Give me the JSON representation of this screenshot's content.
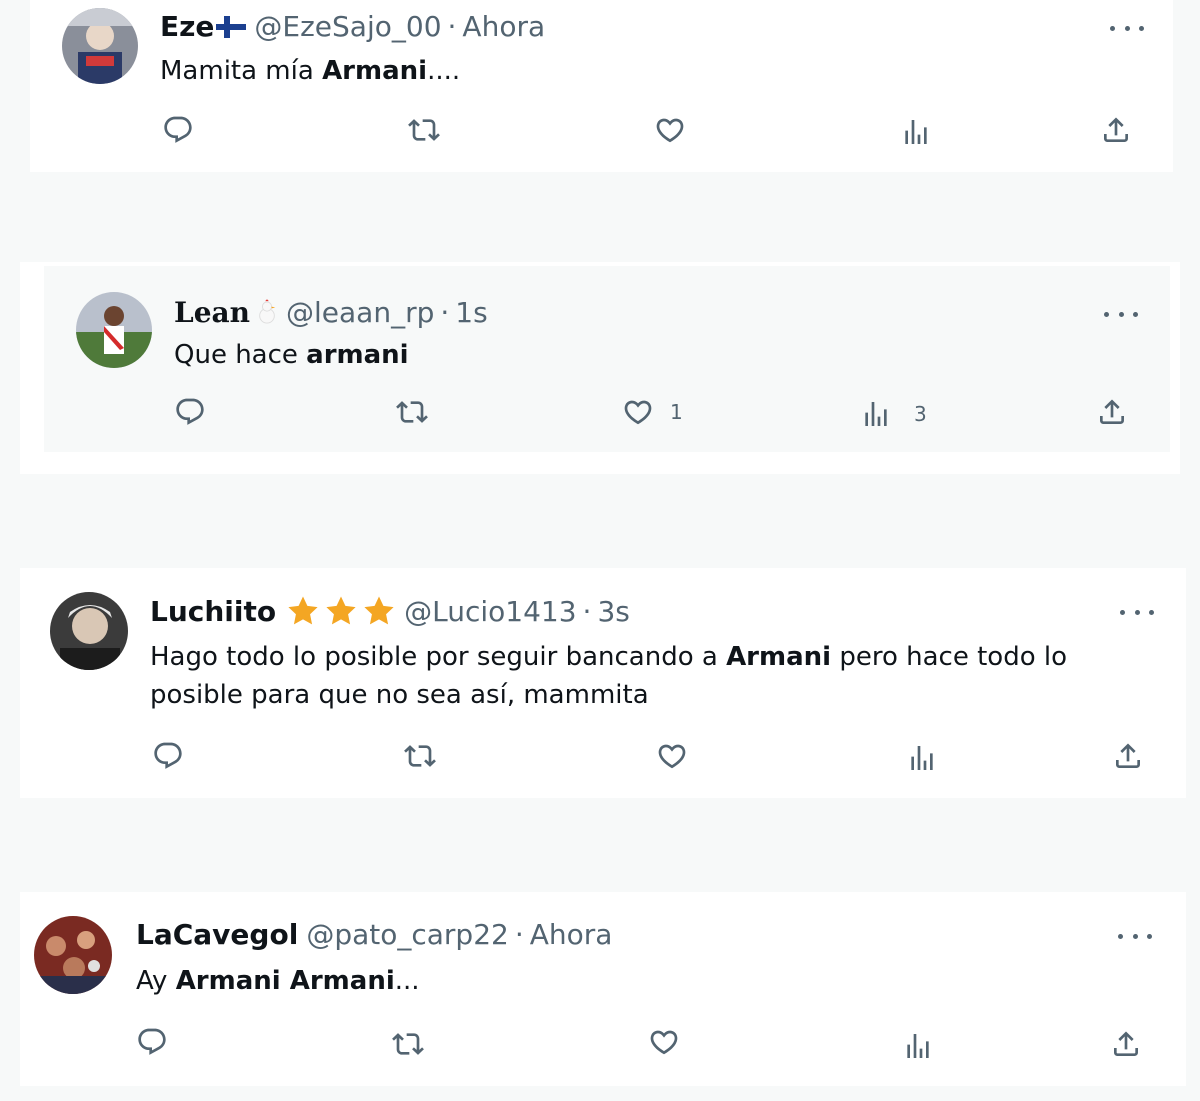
{
  "tweets": [
    {
      "name": "Eze",
      "handle": "@EzeSajo_00",
      "sep": "·",
      "time": "Ahora",
      "text_pre": "Mamita mía ",
      "text_bold": "Armani",
      "text_post": "....",
      "flag": "finland-flag-icon"
    },
    {
      "name": "Lean",
      "handle": "@leaan_rp",
      "sep": "·",
      "time": "1s",
      "text_pre": "Que hace ",
      "text_bold": "armani",
      "likes": "1",
      "views": "3",
      "emoji": "chicken-icon"
    },
    {
      "name": "Luchiito",
      "handle": "@Lucio1413",
      "sep": "·",
      "time": "3s",
      "text_pre": "Hago todo lo posible por seguir bancando a ",
      "text_bold": "Armani",
      "text_post": " pero hace todo lo",
      "text_line2": "posible para que no sea así, mammita",
      "stars": 3
    },
    {
      "name": "LaCavegol",
      "handle": "@pato_carp22",
      "sep": "·",
      "time": "Ahora",
      "text_pre": "Ay ",
      "text_bold": "Armani Armani",
      "text_post": "..."
    }
  ],
  "colors": {
    "page_bg": "#f7f9f9",
    "card_bg": "#ffffff",
    "text": "#0f1419",
    "muted": "#536471",
    "star": "#f4a623"
  },
  "icons": [
    "reply-icon",
    "retweet-icon",
    "like-icon",
    "views-icon",
    "share-icon",
    "more-icon"
  ]
}
